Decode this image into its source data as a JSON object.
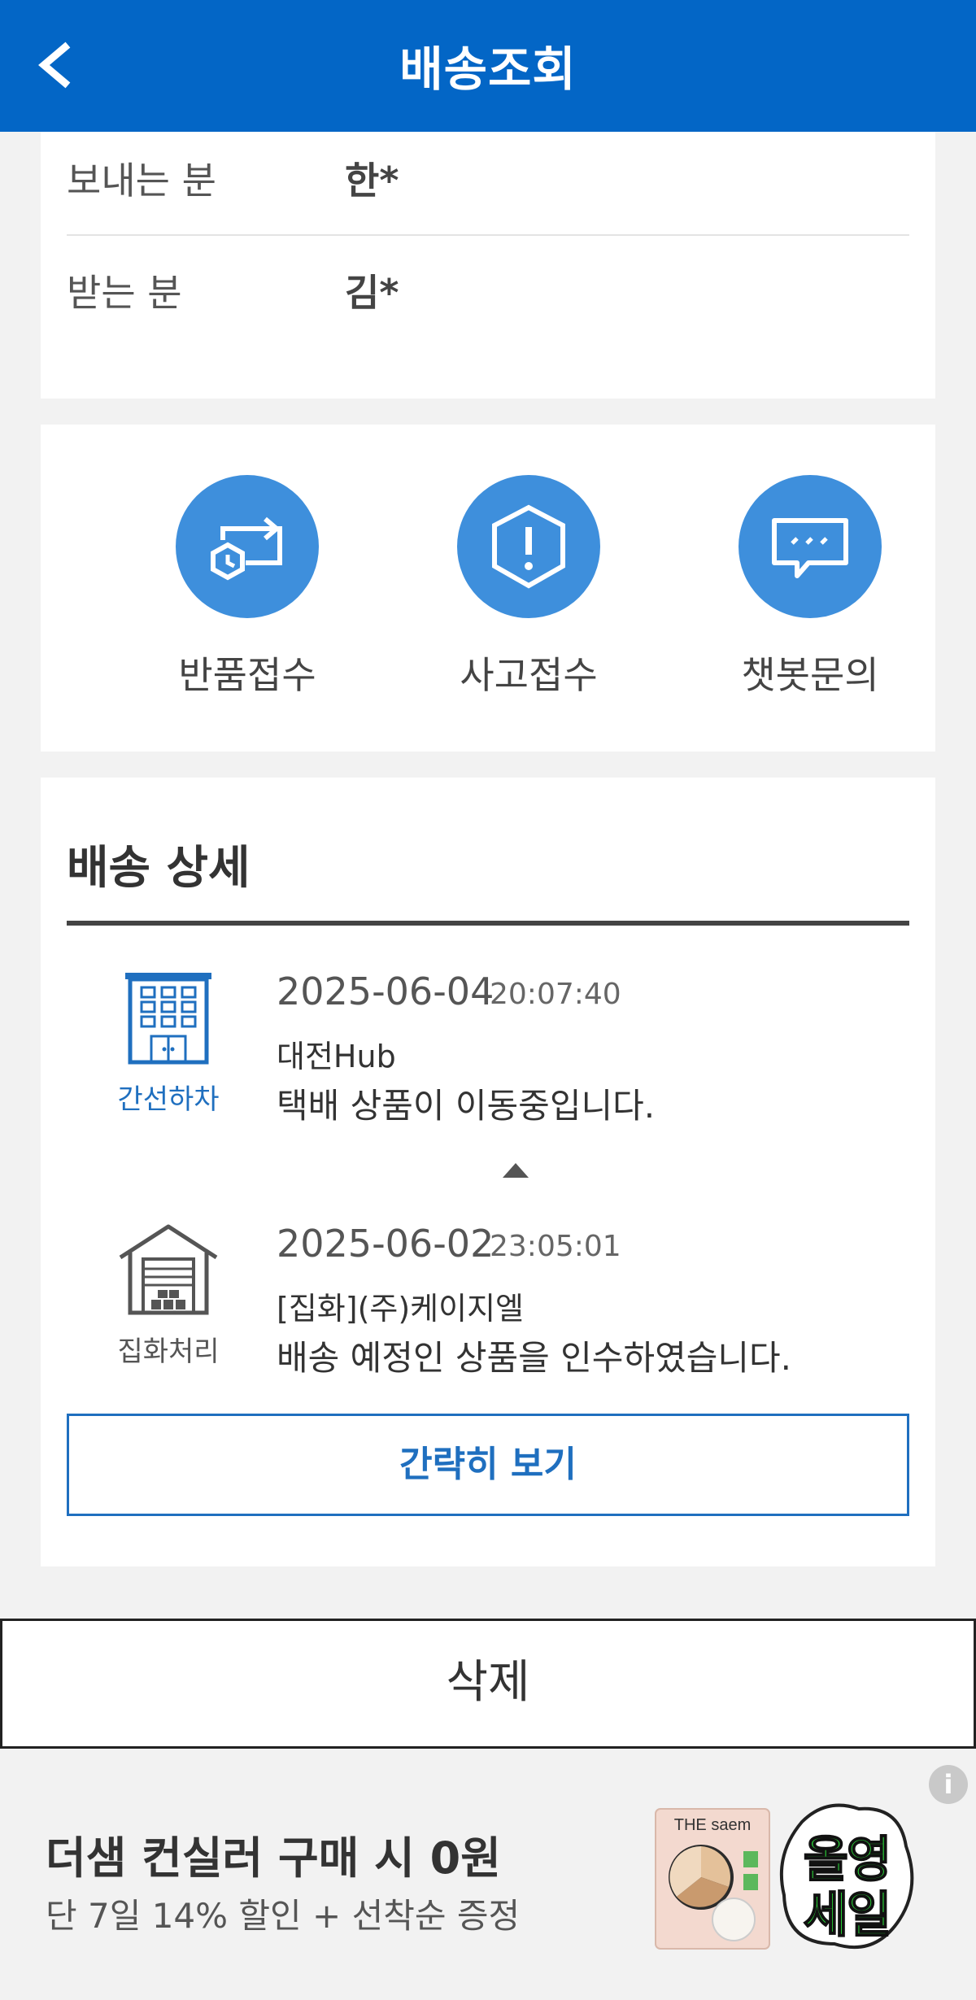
{
  "header": {
    "title": "배송조회"
  },
  "info": {
    "sender_label": "보내는 분",
    "sender_value": "한*",
    "receiver_label": "받는 분",
    "receiver_value": "김*"
  },
  "actions": [
    {
      "label": "반품접수",
      "icon": "return-exchange-icon"
    },
    {
      "label": "사고접수",
      "icon": "warning-hexagon-icon"
    },
    {
      "label": "챗봇문의",
      "icon": "chat-bubble-icon"
    }
  ],
  "detail": {
    "title": "배송 상세",
    "events": [
      {
        "type": "간선하차",
        "icon": "building-icon",
        "date": "2025-06-04",
        "time": "20:07:40",
        "location": "대전Hub",
        "description": "택배 상품이 이동중입니다."
      },
      {
        "type": "집화처리",
        "icon": "warehouse-icon",
        "date": "2025-06-02",
        "time": "23:05:01",
        "location": "[집화](주)케이지엘",
        "description": "배송 예정인 상품을 인수하였습니다."
      }
    ],
    "brief_button": "간략히 보기"
  },
  "delete_button": "삭제",
  "ad": {
    "headline": "더샘 컨실러 구매 시 0원",
    "subline": "단 7일 14% 할인 + 선착순 증정",
    "info_badge": "i",
    "product_brand": "THE saem",
    "sale_text_1": "올영",
    "sale_text_2": "세일"
  },
  "colors": {
    "header_bg": "#0366c6",
    "icon_circle": "#3e8fdc",
    "accent_blue": "#1f6fbf"
  }
}
